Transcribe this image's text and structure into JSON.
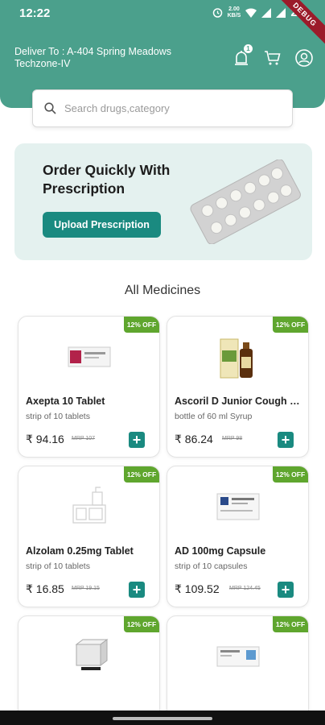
{
  "status_bar": {
    "time": "12:22",
    "network_speed": "2.00\nKB/S",
    "battery": "22",
    "debug": "DEBUG"
  },
  "header": {
    "deliver_label": "Deliver To :",
    "address": "A-404 Spring Meadows Techzone-IV",
    "notification_count": "1",
    "icons": [
      "notification-bell-icon",
      "cart-icon",
      "profile-icon"
    ]
  },
  "search": {
    "placeholder": "Search drugs,category"
  },
  "banner": {
    "title": "Order Quickly With Prescription",
    "button_label": "Upload Prescription"
  },
  "section_title": "All Medicines",
  "products": [
    {
      "name": "Axepta 10 Tablet",
      "pack": "strip of 10 tablets",
      "price": "₹ 94.16",
      "mrp": "MRP 107",
      "discount": "12% OFF"
    },
    {
      "name": "Ascoril D Junior Cough Syrup",
      "pack": "bottle of 60 ml Syrup",
      "price": "₹ 86.24",
      "mrp": "MRP 98",
      "discount": "12% OFF"
    },
    {
      "name": "Alzolam 0.25mg Tablet",
      "pack": "strip of 10 tablets",
      "price": "₹ 16.85",
      "mrp": "MRP 19.15",
      "discount": "12% OFF"
    },
    {
      "name": "AD 100mg Capsule",
      "pack": "strip of 10 capsules",
      "price": "₹ 109.52",
      "mrp": "MRP 124.45",
      "discount": "12% OFF"
    },
    {
      "name": "",
      "pack": "",
      "price": "",
      "mrp": "",
      "discount": "12% OFF"
    },
    {
      "name": "",
      "pack": "",
      "price": "",
      "mrp": "",
      "discount": "12% OFF"
    }
  ],
  "colors": {
    "primary": "#4ba08c",
    "button": "#1a8a80",
    "discount": "#5fa62e",
    "banner_bg": "#e4f1ef"
  }
}
